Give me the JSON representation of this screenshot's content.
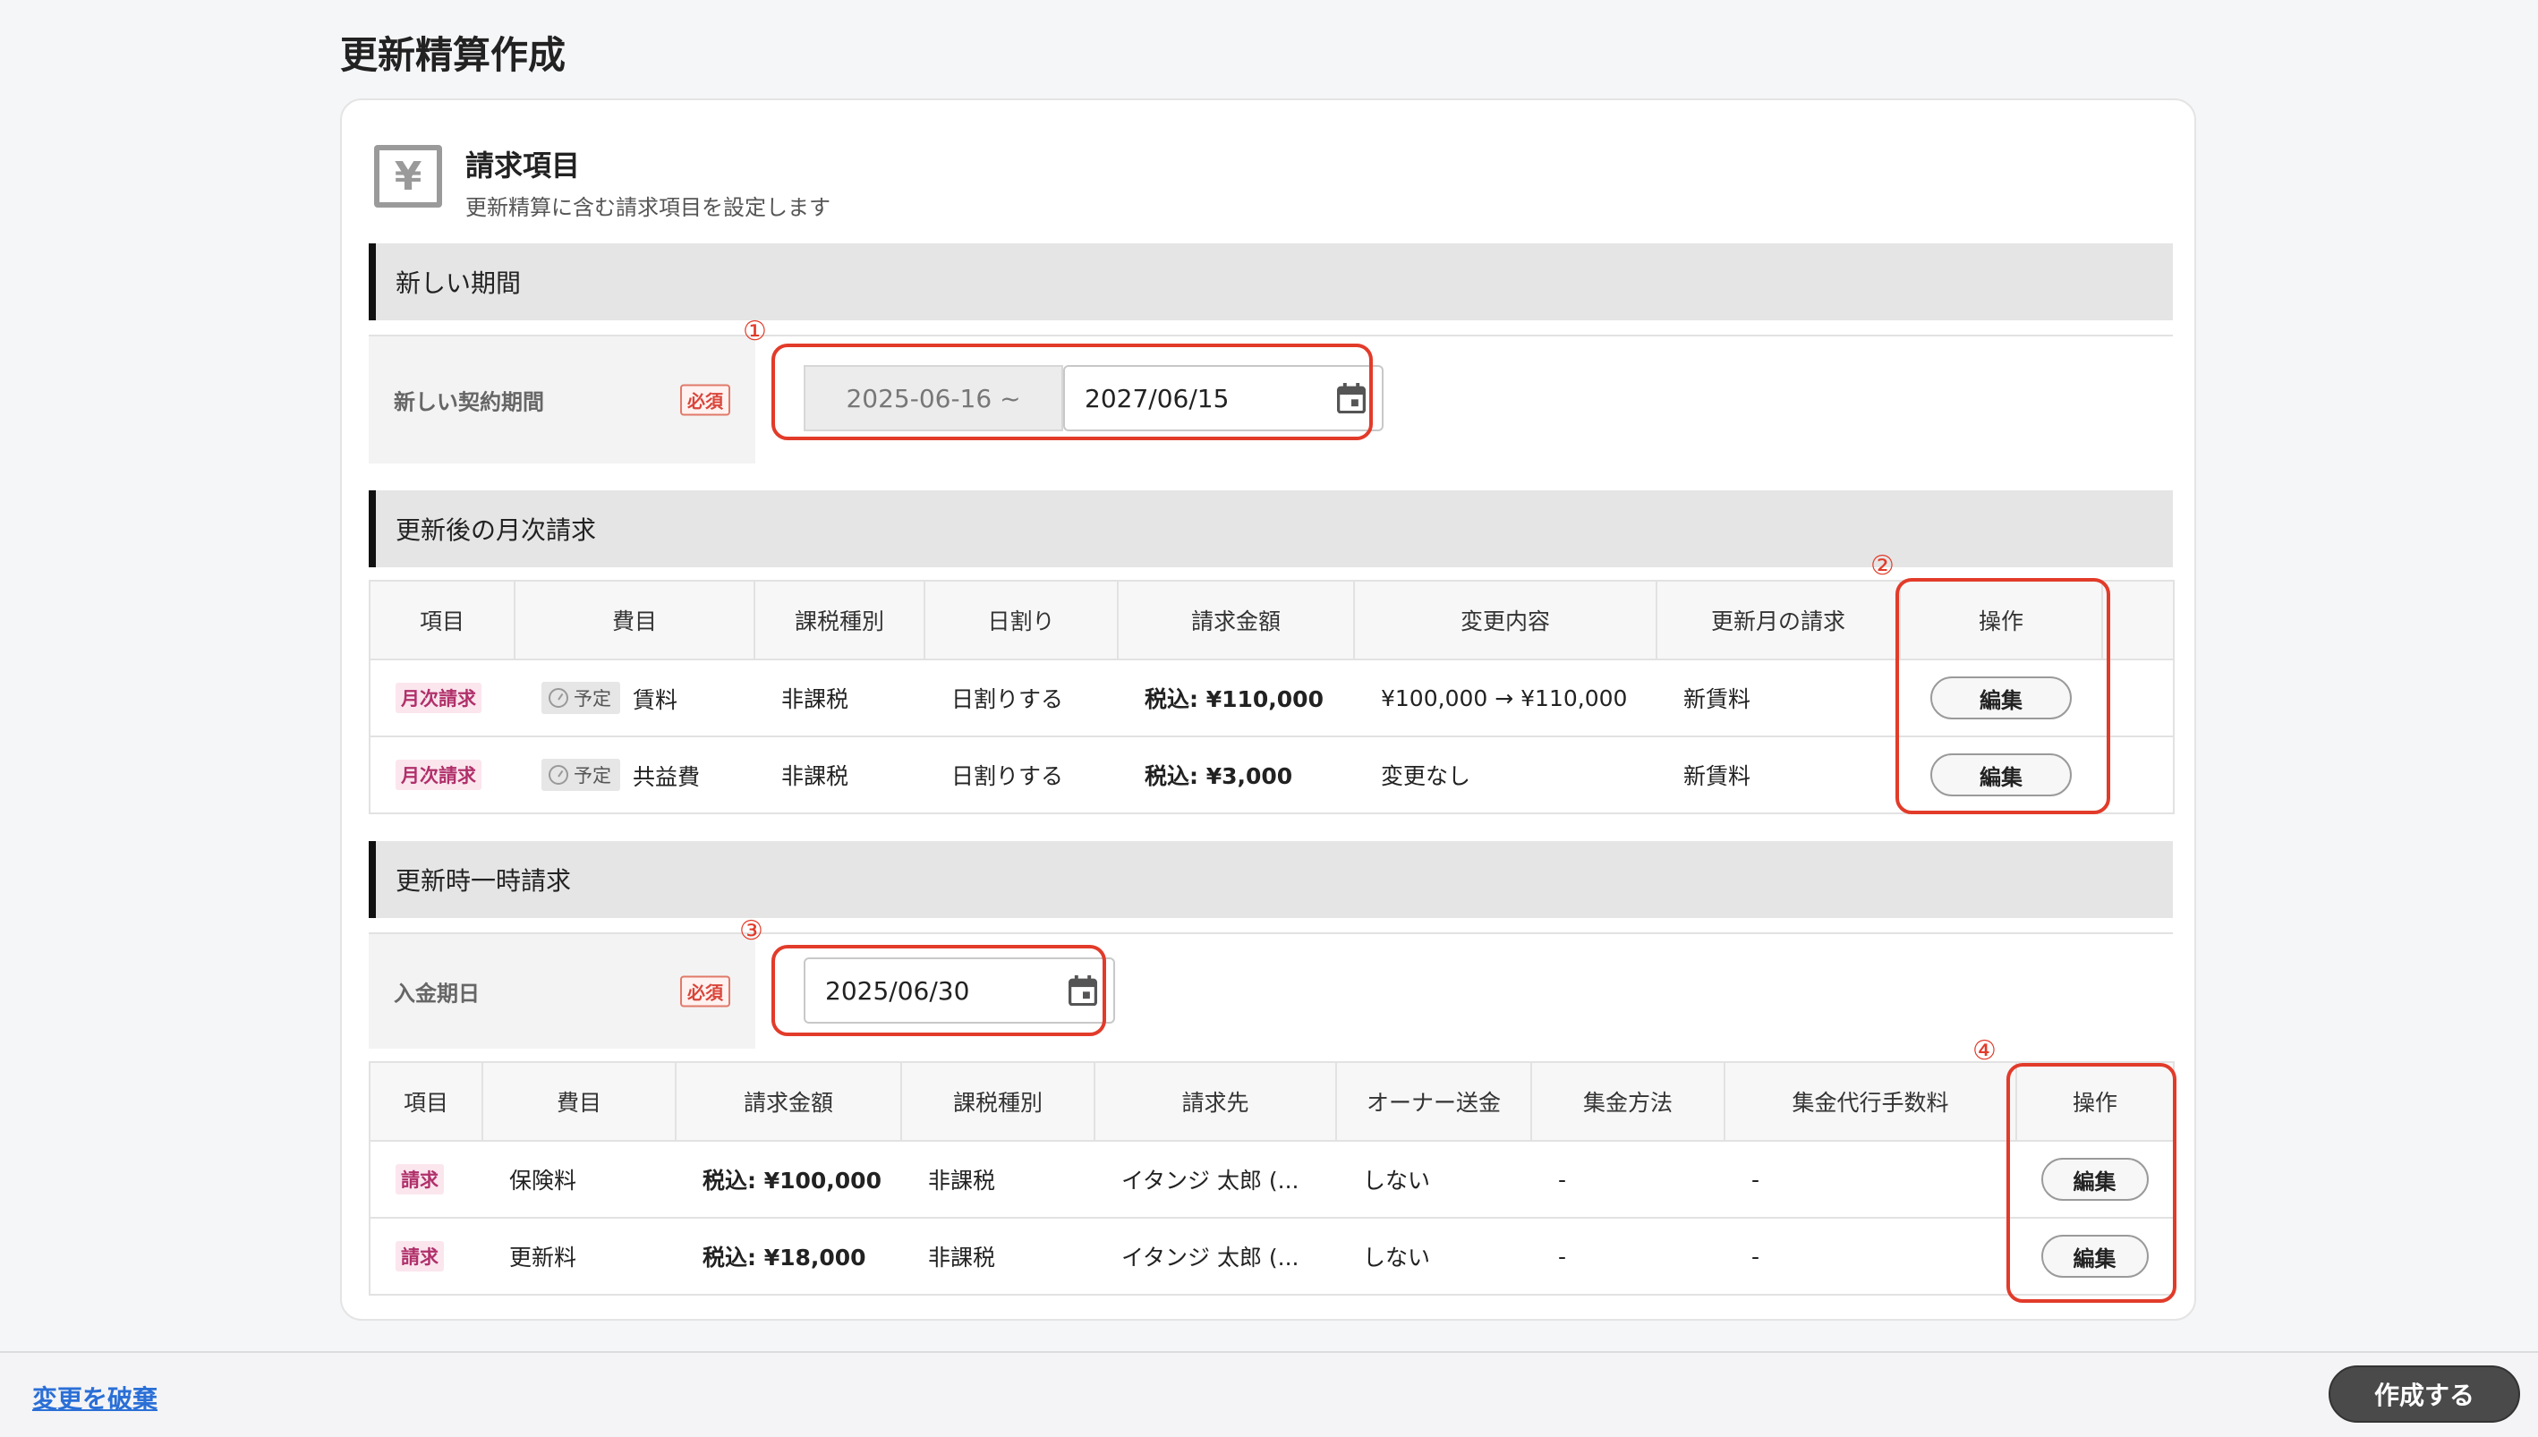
{
  "page_title": "更新精算作成",
  "card": {
    "icon": "yen-icon",
    "icon_glyph": "¥",
    "title": "請求項目",
    "subtitle": "更新精算に含む請求項目を設定します"
  },
  "markers": {
    "m1": "①",
    "m2": "②",
    "m3": "③",
    "m4": "④"
  },
  "new_period": {
    "section_title": "新しい期間",
    "label": "新しい契約期間",
    "required": "必須",
    "start": "2025-06-16 ~",
    "end": "2027/06/15"
  },
  "monthly": {
    "section_title": "更新後の月次請求",
    "headers": [
      "項目",
      "費目",
      "課税種別",
      "日割り",
      "請求金額",
      "変更内容",
      "更新月の請求",
      "操作"
    ],
    "rows": [
      {
        "type": "月次請求",
        "status": "予定",
        "item": "賃料",
        "tax": "非課税",
        "prorate": "日割りする",
        "amount": "税込: ¥110,000",
        "change": "¥100,000 → ¥110,000",
        "renewal_month": "新賃料",
        "action": "編集"
      },
      {
        "type": "月次請求",
        "status": "予定",
        "item": "共益費",
        "tax": "非課税",
        "prorate": "日割りする",
        "amount": "税込: ¥3,000",
        "change": "変更なし",
        "renewal_month": "新賃料",
        "action": "編集"
      }
    ]
  },
  "onetime": {
    "section_title": "更新時一時請求",
    "label": "入金期日",
    "required": "必須",
    "due_date": "2025/06/30",
    "headers": [
      "項目",
      "費目",
      "請求金額",
      "課税種別",
      "請求先",
      "オーナー送金",
      "集金方法",
      "集金代行手数料",
      "操作"
    ],
    "rows": [
      {
        "type": "請求",
        "item": "保険料",
        "amount": "税込: ¥100,000",
        "tax": "非課税",
        "payer": "イタンジ 太郎 (...",
        "owner_remit": "しない",
        "method": "-",
        "fee": "-",
        "action": "編集"
      },
      {
        "type": "請求",
        "item": "更新料",
        "amount": "税込: ¥18,000",
        "tax": "非課税",
        "payer": "イタンジ 太郎 (...",
        "owner_remit": "しない",
        "method": "-",
        "fee": "-",
        "action": "編集"
      }
    ]
  },
  "footer": {
    "discard": "変更を破棄",
    "create": "作成する"
  }
}
